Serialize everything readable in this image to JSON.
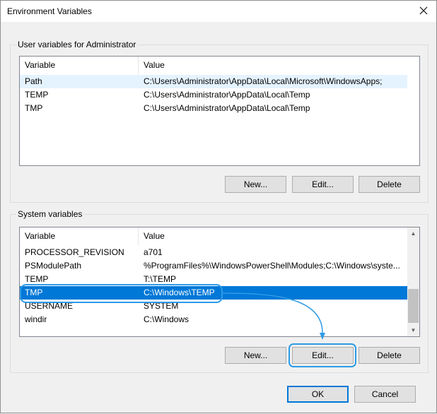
{
  "window": {
    "title": "Environment Variables"
  },
  "user_group": {
    "title": "User variables for Administrator",
    "columns": [
      "Variable",
      "Value"
    ],
    "rows": [
      {
        "name": "Path",
        "value": "C:\\Users\\Administrator\\AppData\\Local\\Microsoft\\WindowsApps;"
      },
      {
        "name": "TEMP",
        "value": "C:\\Users\\Administrator\\AppData\\Local\\Temp"
      },
      {
        "name": "TMP",
        "value": "C:\\Users\\Administrator\\AppData\\Local\\Temp"
      }
    ],
    "buttons": {
      "new": "New...",
      "edit": "Edit...",
      "delete": "Delete"
    }
  },
  "system_group": {
    "title": "System variables",
    "columns": [
      "Variable",
      "Value"
    ],
    "rows": [
      {
        "name": "PROCESSOR_REVISION",
        "value": "a701"
      },
      {
        "name": "PSModulePath",
        "value": "%ProgramFiles%\\WindowsPowerShell\\Modules;C:\\Windows\\syste..."
      },
      {
        "name": "TEMP",
        "value": "T:\\TEMP"
      },
      {
        "name": "TMP",
        "value": "C:\\Windows\\TEMP"
      },
      {
        "name": "USERNAME",
        "value": "SYSTEM"
      },
      {
        "name": "windir",
        "value": "C:\\Windows"
      }
    ],
    "buttons": {
      "new": "New...",
      "edit": "Edit...",
      "delete": "Delete"
    }
  },
  "footer": {
    "ok": "OK",
    "cancel": "Cancel"
  },
  "colors": {
    "selection": "#0078d7",
    "annotation": "#2e9be6"
  }
}
